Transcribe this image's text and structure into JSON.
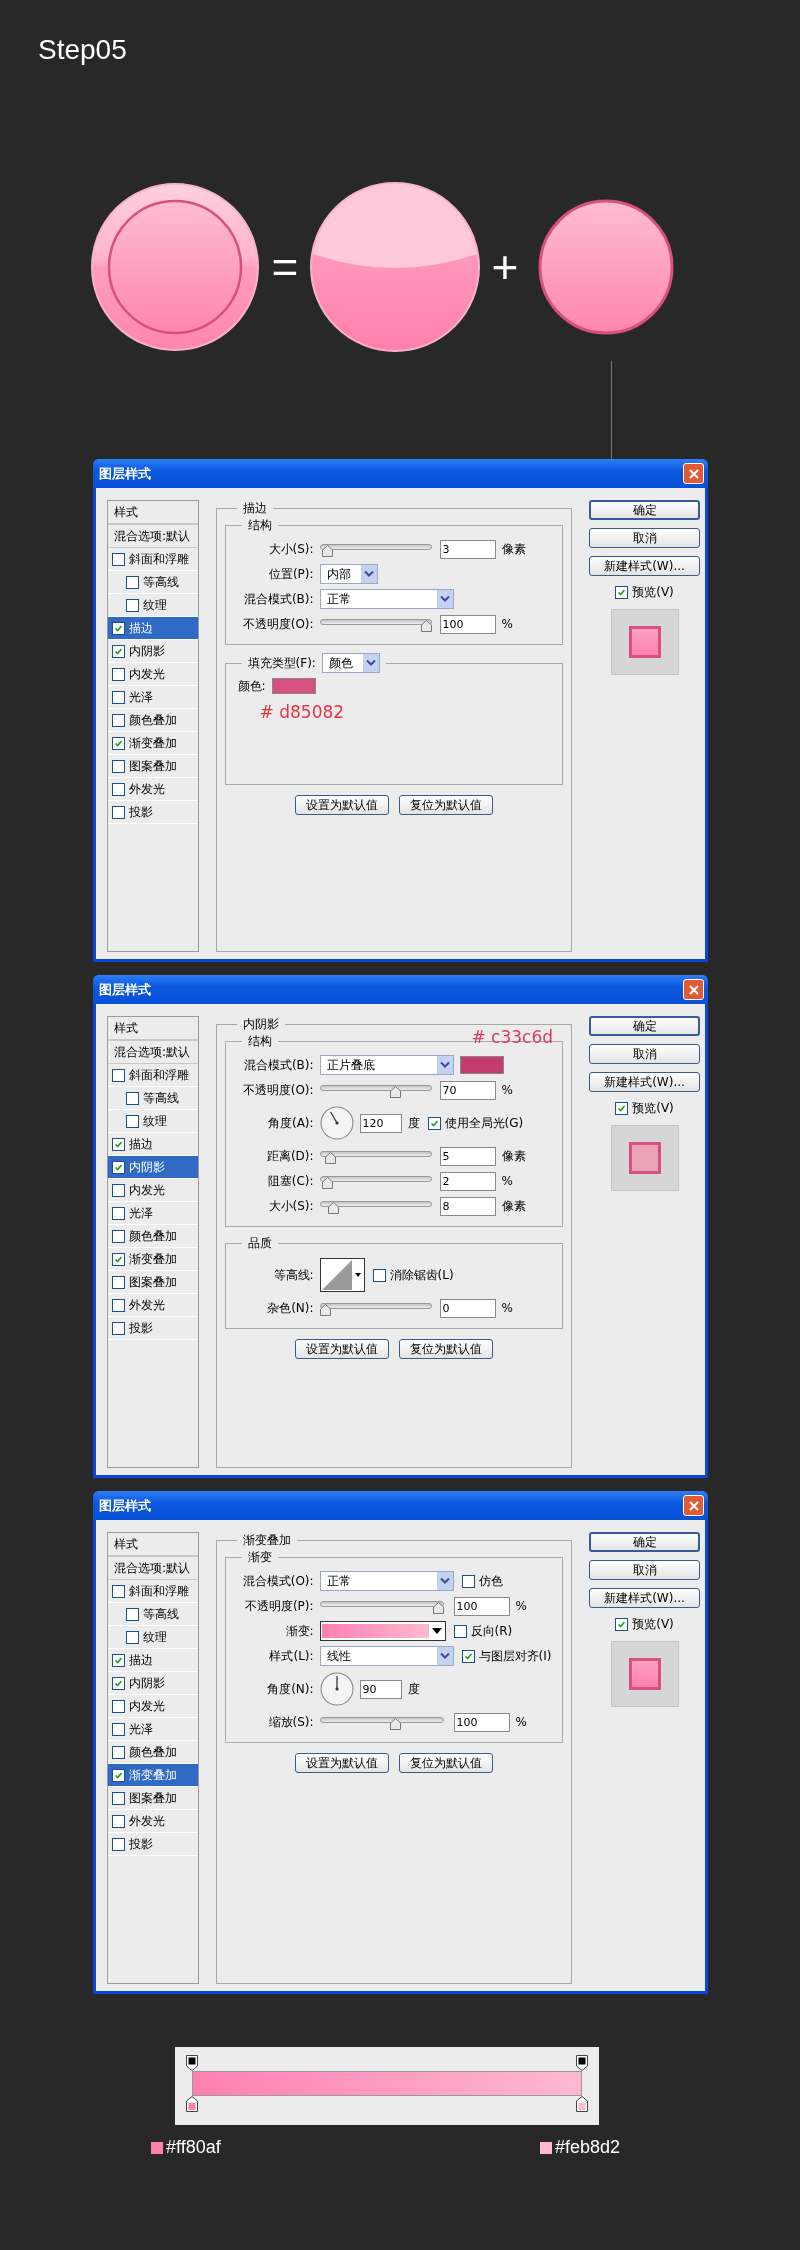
{
  "title": "Step05",
  "illustration": {
    "operators": [
      "=",
      "+"
    ]
  },
  "dialogs": [
    {
      "title": "图层样式",
      "list_header": "样式",
      "blend_options": "混合选项:默认",
      "styles": [
        {
          "label": "斜面和浮雕",
          "checked": false,
          "selected": false,
          "children": [
            {
              "label": "等高线",
              "checked": false,
              "selected": false
            },
            {
              "label": "纹理",
              "checked": false,
              "selected": false
            }
          ]
        },
        {
          "label": "描边",
          "checked": true,
          "selected": true
        },
        {
          "label": "内阴影",
          "checked": true,
          "selected": false
        },
        {
          "label": "内发光",
          "checked": false,
          "selected": false
        },
        {
          "label": "光泽",
          "checked": false,
          "selected": false
        },
        {
          "label": "颜色叠加",
          "checked": false,
          "selected": false
        },
        {
          "label": "渐变叠加",
          "checked": true,
          "selected": false
        },
        {
          "label": "图案叠加",
          "checked": false,
          "selected": false
        },
        {
          "label": "外发光",
          "checked": false,
          "selected": false
        },
        {
          "label": "投影",
          "checked": false,
          "selected": false
        }
      ],
      "section": {
        "title": "描边",
        "groups": [
          {
            "title": "结构",
            "rows": [
              {
                "kind": "slider",
                "label": "大小(S):",
                "level": 0.02,
                "value": "3",
                "unit": "像素"
              },
              {
                "kind": "short_select",
                "label": "位置(P):",
                "value": "内部"
              },
              {
                "kind": "select",
                "label": "混合模式(B):",
                "value": "正常"
              },
              {
                "kind": "slider",
                "label": "不透明度(O):",
                "level": 1,
                "value": "100",
                "unit": "%"
              }
            ]
          },
          {
            "legend_select": {
              "label": "填充类型(F):",
              "value": "颜色"
            },
            "rows": [
              {
                "kind": "color",
                "label": "颜色:",
                "color": "#d85082"
              }
            ],
            "annotation": "# d85082"
          }
        ],
        "reset_buttons": [
          "设置为默认值",
          "复位为默认值"
        ]
      },
      "buttons": [
        "确定",
        "取消",
        "新建样式(W)..."
      ],
      "preview": {
        "label": "预览(V)",
        "checked": true
      }
    },
    {
      "title": "图层样式",
      "list_header": "样式",
      "blend_options": "混合选项:默认",
      "styles": [
        {
          "label": "斜面和浮雕",
          "checked": false,
          "selected": false,
          "children": [
            {
              "label": "等高线",
              "checked": false,
              "selected": false
            },
            {
              "label": "纹理",
              "checked": false,
              "selected": false
            }
          ]
        },
        {
          "label": "描边",
          "checked": true,
          "selected": false
        },
        {
          "label": "内阴影",
          "checked": true,
          "selected": true
        },
        {
          "label": "内发光",
          "checked": false,
          "selected": false
        },
        {
          "label": "光泽",
          "checked": false,
          "selected": false
        },
        {
          "label": "颜色叠加",
          "checked": false,
          "selected": false
        },
        {
          "label": "渐变叠加",
          "checked": true,
          "selected": false
        },
        {
          "label": "图案叠加",
          "checked": false,
          "selected": false
        },
        {
          "label": "外发光",
          "checked": false,
          "selected": false
        },
        {
          "label": "投影",
          "checked": false,
          "selected": false
        }
      ],
      "section": {
        "title": "内阴影",
        "annotation": "# c33c6d",
        "groups": [
          {
            "title": "结构",
            "rows": [
              {
                "kind": "select",
                "label": "混合模式(B):",
                "value": "正片叠底",
                "color": "#c33c6d"
              },
              {
                "kind": "slider",
                "label": "不透明度(O):",
                "level": 0.7,
                "value": "70",
                "unit": "%"
              },
              {
                "kind": "angle",
                "label": "角度(A):",
                "value": "120",
                "unit": "度",
                "checkbox": {
                  "label": "使用全局光(G)",
                  "checked": true
                }
              },
              {
                "kind": "slider",
                "label": "距离(D):",
                "level": 0.05,
                "value": "5",
                "unit": "像素"
              },
              {
                "kind": "slider",
                "label": "阻塞(C):",
                "level": 0.02,
                "value": "2",
                "unit": "%"
              },
              {
                "kind": "slider",
                "label": "大小(S):",
                "level": 0.08,
                "value": "8",
                "unit": "像素"
              }
            ]
          },
          {
            "title": "品质",
            "rows": [
              {
                "kind": "contour",
                "label": "等高线:",
                "checkbox": {
                  "label": "消除锯齿(L)",
                  "checked": false
                }
              },
              {
                "kind": "slider",
                "label": "杂色(N):",
                "level": 0,
                "value": "0",
                "unit": "%"
              }
            ]
          }
        ],
        "reset_buttons": [
          "设置为默认值",
          "复位为默认值"
        ]
      },
      "buttons": [
        "确定",
        "取消",
        "新建样式(W)..."
      ],
      "preview": {
        "label": "预览(V)",
        "checked": true
      }
    },
    {
      "title": "图层样式",
      "list_header": "样式",
      "blend_options": "混合选项:默认",
      "styles": [
        {
          "label": "斜面和浮雕",
          "checked": false,
          "selected": false,
          "children": [
            {
              "label": "等高线",
              "checked": false,
              "selected": false
            },
            {
              "label": "纹理",
              "checked": false,
              "selected": false
            }
          ]
        },
        {
          "label": "描边",
          "checked": true,
          "selected": false
        },
        {
          "label": "内阴影",
          "checked": true,
          "selected": false
        },
        {
          "label": "内发光",
          "checked": false,
          "selected": false
        },
        {
          "label": "光泽",
          "checked": false,
          "selected": false
        },
        {
          "label": "颜色叠加",
          "checked": false,
          "selected": false
        },
        {
          "label": "渐变叠加",
          "checked": true,
          "selected": true
        },
        {
          "label": "图案叠加",
          "checked": false,
          "selected": false
        },
        {
          "label": "外发光",
          "checked": false,
          "selected": false
        },
        {
          "label": "投影",
          "checked": false,
          "selected": false
        }
      ],
      "section": {
        "title": "渐变叠加",
        "groups": [
          {
            "title": "渐变",
            "rows": [
              {
                "kind": "select",
                "label": "混合模式(O):",
                "value": "正常",
                "checkbox": {
                  "label": "仿色",
                  "checked": false
                }
              },
              {
                "kind": "slider",
                "label": "不透明度(P):",
                "level": 1,
                "value": "100",
                "unit": "%"
              },
              {
                "kind": "gradient",
                "label": "渐变:",
                "checkbox": {
                  "label": "反向(R)",
                  "checked": false
                }
              },
              {
                "kind": "select",
                "label": "样式(L):",
                "value": "线性",
                "checkbox": {
                  "label": "与图层对齐(I)",
                  "checked": true
                }
              },
              {
                "kind": "angle",
                "label": "角度(N):",
                "value": "90",
                "unit": "度"
              },
              {
                "kind": "slider",
                "label": "缩放(S):",
                "level": 0.62,
                "value": "100",
                "unit": "%"
              }
            ]
          }
        ],
        "reset_buttons": [
          "设置为默认值",
          "复位为默认值"
        ]
      },
      "buttons": [
        "确定",
        "取消",
        "新建样式(W)..."
      ],
      "preview": {
        "label": "预览(V)",
        "checked": true
      }
    }
  ],
  "gradient_editor": {
    "stops": [
      {
        "label": "#ff80af",
        "color": "#ff80af"
      },
      {
        "label": "#feb8d2",
        "color": "#feb8d2"
      }
    ]
  }
}
